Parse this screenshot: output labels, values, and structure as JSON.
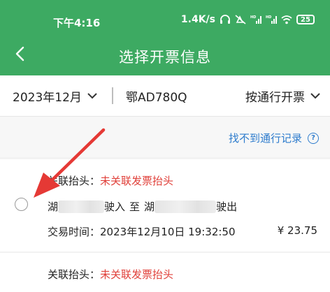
{
  "status_bar": {
    "time": "下午4:16",
    "net_speed": "1.4K/s",
    "battery": "25",
    "icons": [
      "headset-icon",
      "mute-icon",
      "hd-signal-icon",
      "hd-signal-icon",
      "wifi-icon",
      "battery-icon"
    ]
  },
  "navbar": {
    "title": "选择开票信息",
    "back_icon": "back-arrow-icon"
  },
  "filters": {
    "date": "2023年12月",
    "plate": "鄂AD780Q",
    "mode": "按通行开票"
  },
  "hint": {
    "link_text": "找不到通行记录",
    "icon": "question-icon"
  },
  "records": [
    {
      "header_label": "关联抬头：",
      "header_value": "未关联发票抬头",
      "entry_prefix": "湖",
      "entry_word": "驶入",
      "to_word": "至",
      "exit_prefix": "湖",
      "exit_word": "驶出",
      "time_label": "交易时间：",
      "time_value": "2023年12月10日 19:32:50",
      "amount": "¥ 23.75"
    },
    {
      "header_label": "关联抬头：",
      "header_value": "未关联发票抬头"
    }
  ],
  "colors": {
    "brand_green": "#3daa62",
    "link_blue": "#2e7ccd",
    "alert_red": "#e0403a",
    "annotation_arrow": "#e53935"
  }
}
